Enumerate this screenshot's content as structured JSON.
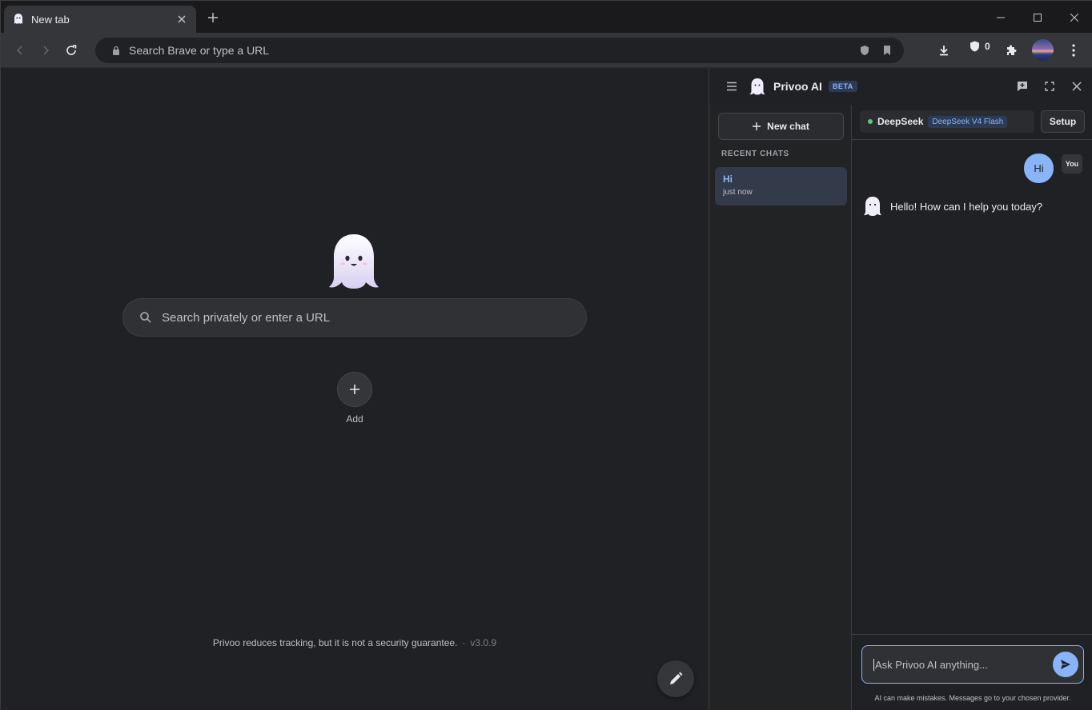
{
  "browser": {
    "tab_title": "New tab",
    "omnibox_placeholder": "Search Brave or type a URL",
    "shields_count": "0"
  },
  "page": {
    "search_placeholder": "Search privately or enter a URL",
    "add_label": "Add",
    "footer_text": "Privoo reduces tracking, but it is not a security guarantee.",
    "footer_separator": "·",
    "version": "v3.0.9"
  },
  "panel": {
    "title": "Privoo AI",
    "badge": "BETA",
    "new_chat_label": "New chat",
    "recent_heading": "RECENT CHATS",
    "recent_chats": [
      {
        "title": "Hi",
        "time": "just now"
      }
    ],
    "provider": "DeepSeek",
    "model": "DeepSeek V4 Flash",
    "setup_label": "Setup",
    "messages": [
      {
        "role": "user",
        "text": "Hi",
        "badge": "You"
      },
      {
        "role": "assistant",
        "text": "Hello! How can I help you today?"
      }
    ],
    "input_placeholder": "Ask Privoo AI anything...",
    "disclaimer": "AI can make mistakes. Messages go to your chosen provider."
  },
  "colors": {
    "accent": "#8ab4f8",
    "background": "#202124",
    "status_online": "#5fc97b"
  },
  "icons": [
    "ghost-icon",
    "close-icon",
    "plus-icon",
    "back-icon",
    "forward-icon",
    "reload-icon",
    "lock-icon",
    "shield-icon",
    "bookmark-icon",
    "download-icon",
    "extensions-icon",
    "kebab-menu-icon",
    "search-icon",
    "pencil-icon",
    "hamburger-icon",
    "new-chat-icon",
    "expand-icon",
    "send-icon"
  ]
}
